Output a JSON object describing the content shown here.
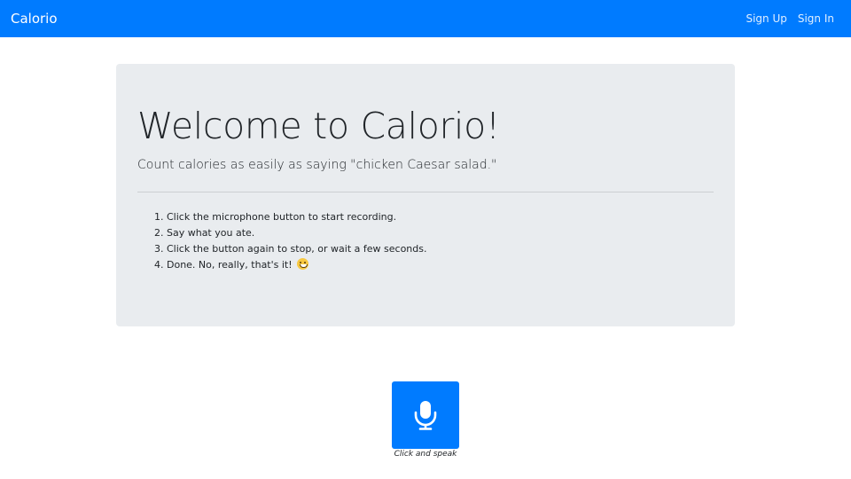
{
  "navbar": {
    "brand": "Calorio",
    "links": [
      {
        "label": "Sign Up"
      },
      {
        "label": "Sign In"
      }
    ]
  },
  "jumbotron": {
    "title": "Welcome to Calorio!",
    "lead": "Count calories as easily as saying \"chicken Caesar salad.\"",
    "steps": [
      "1. Click the microphone button to start recording.",
      "2. Say what you ate.",
      "3. Click the button again to stop, or wait a few seconds.",
      "4. Done. No, really, that's it!"
    ]
  },
  "recorder": {
    "icon": "microphone-icon",
    "caption": "Click and speak"
  },
  "colors": {
    "primary": "#007bff",
    "jumbotron_bg": "#e9ecef",
    "text": "#212529"
  }
}
